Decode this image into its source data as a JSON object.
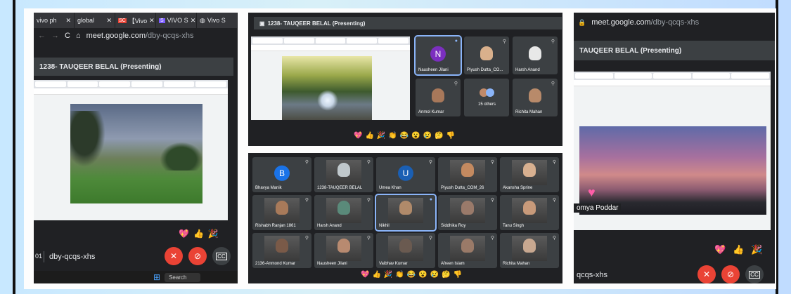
{
  "panel1": {
    "tabs": [
      {
        "label": "vivo ph",
        "close": "✕"
      },
      {
        "label": "global",
        "close": "✕"
      },
      {
        "label": "【Vivo",
        "close": "✕"
      },
      {
        "label": "VIVO S",
        "close": "✕"
      },
      {
        "label": "Vivo S",
        "close": ""
      }
    ],
    "url_main": "meet.google.com",
    "url_path": "/dby-qcqs-xhs",
    "presenting": "1238- TAUQEER BELAL (Presenting)",
    "meeting_code": "dby-qcqs-xhs",
    "meeting_prefix": "01",
    "taskbar_search": "Search"
  },
  "panel2": {
    "presenting": "1238- TAUQEER BELAL (Presenting)",
    "participants": [
      {
        "name": "Nausheen Jilani",
        "initial": "N",
        "color": "#7b2fbf"
      },
      {
        "name": "Piyush Dutta_CO..."
      },
      {
        "name": "Harsh Anand"
      },
      {
        "name": "Anmol Kumar"
      },
      {
        "name": "15 others"
      },
      {
        "name": "Richita Mahan"
      }
    ]
  },
  "panel3": {
    "participants": [
      {
        "name": "Bhavya Manik",
        "initial": "B",
        "color": "#1a73e8"
      },
      {
        "name": "1238-TAUQEER BELAL"
      },
      {
        "name": "Umea Khan",
        "initial": "U",
        "color": "#1a5fb4"
      },
      {
        "name": "Piyush Dutta_COM_26"
      },
      {
        "name": "Akansha Sprine"
      },
      {
        "name": "Rishabh Ranjan 1861"
      },
      {
        "name": "Harsh Anand"
      },
      {
        "name": "Nikhil"
      },
      {
        "name": "Siddhika Roy"
      },
      {
        "name": "Tanu Singh"
      },
      {
        "name": "2136-Anmond Kumar"
      },
      {
        "name": "Nausheen Jilani"
      },
      {
        "name": "Vaibhav Kumar"
      },
      {
        "name": "Afreen Islam"
      },
      {
        "name": "Richita Mahan"
      }
    ]
  },
  "panel4": {
    "url_main": "meet.google.com",
    "url_path": "/dby-qcqs-xhs",
    "presenting": "TAUQEER BELAL (Presenting)",
    "caption": "omya Poddar",
    "meeting_code": "qcqs-xhs"
  },
  "reactions": [
    "💖",
    "👍",
    "🎉",
    "👏",
    "😂",
    "😮",
    "😢",
    "🤔",
    "👎"
  ],
  "icons": {
    "back": "←",
    "forward": "→",
    "reload": "C",
    "home": "⌂",
    "lock": "🔒",
    "mic_off": "🎤",
    "cam_off": "📷",
    "cc": "CC",
    "windows": "⊞"
  }
}
